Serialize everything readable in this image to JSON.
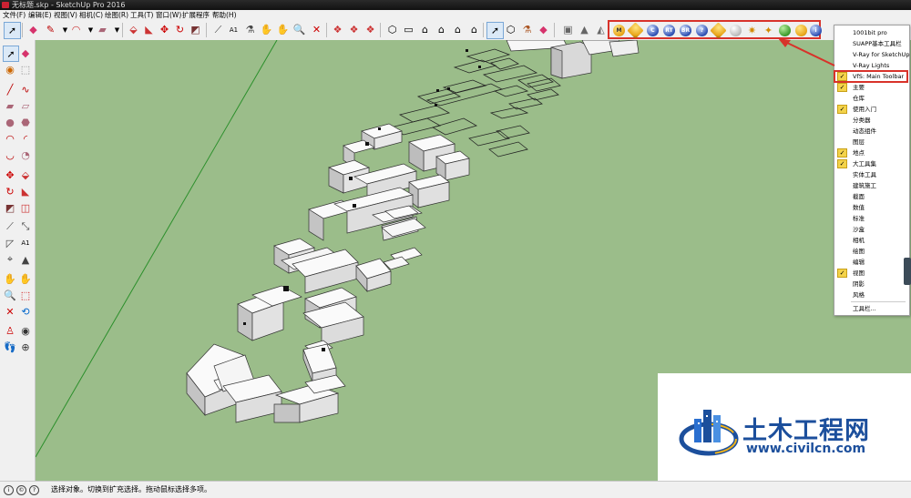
{
  "app": {
    "title": "无标题.skp - SketchUp Pro 2016"
  },
  "menubar": {
    "items": [
      "文件(F)",
      "编辑(E)",
      "视图(V)",
      "相机(C)",
      "绘图(R)",
      "工具(T)",
      "窗口(W)",
      "扩展程序",
      "帮助(H)"
    ]
  },
  "vis_toolbar": {
    "icon_letters": [
      "M",
      "",
      "C",
      "RT",
      "BR",
      "?",
      "",
      "",
      "",
      "",
      "",
      ""
    ]
  },
  "context_menu": {
    "items": [
      {
        "label": "1001bit pro",
        "checked": false
      },
      {
        "label": "SUAPP基本工具栏",
        "checked": false
      },
      {
        "label": "V-Ray for SketchUp",
        "checked": false
      },
      {
        "label": "V-Ray Lights",
        "checked": false
      },
      {
        "label": "VfS: Main Toolbar",
        "checked": true,
        "highlight": true
      },
      {
        "label": "主要",
        "checked": true
      },
      {
        "label": "仓库",
        "checked": false
      },
      {
        "label": "使用入门",
        "checked": true
      },
      {
        "label": "分类器",
        "checked": false
      },
      {
        "label": "动态组件",
        "checked": false
      },
      {
        "label": "图层",
        "checked": false
      },
      {
        "label": "地点",
        "checked": true
      },
      {
        "label": "大工具集",
        "checked": true
      },
      {
        "label": "实体工具",
        "checked": false
      },
      {
        "label": "建筑施工",
        "checked": false
      },
      {
        "label": "截面",
        "checked": false
      },
      {
        "label": "数值",
        "checked": false
      },
      {
        "label": "标准",
        "checked": false
      },
      {
        "label": "沙盒",
        "checked": false
      },
      {
        "label": "相机",
        "checked": false
      },
      {
        "label": "绘图",
        "checked": false
      },
      {
        "label": "编辑",
        "checked": false
      },
      {
        "label": "视图",
        "checked": true
      },
      {
        "label": "阴影",
        "checked": false
      },
      {
        "label": "风格",
        "checked": false
      }
    ],
    "footer": "工具栏..."
  },
  "status": {
    "text": "选择对象。切换到扩充选择。拖动鼠标选择多项。"
  },
  "watermark": {
    "name": "土木工程网",
    "url": "www.civilcn.com"
  },
  "colors": {
    "accent": "#d8322a",
    "ground": "#9bbd8a",
    "check": "#f4d34a",
    "brand": "#1c4f9c"
  }
}
